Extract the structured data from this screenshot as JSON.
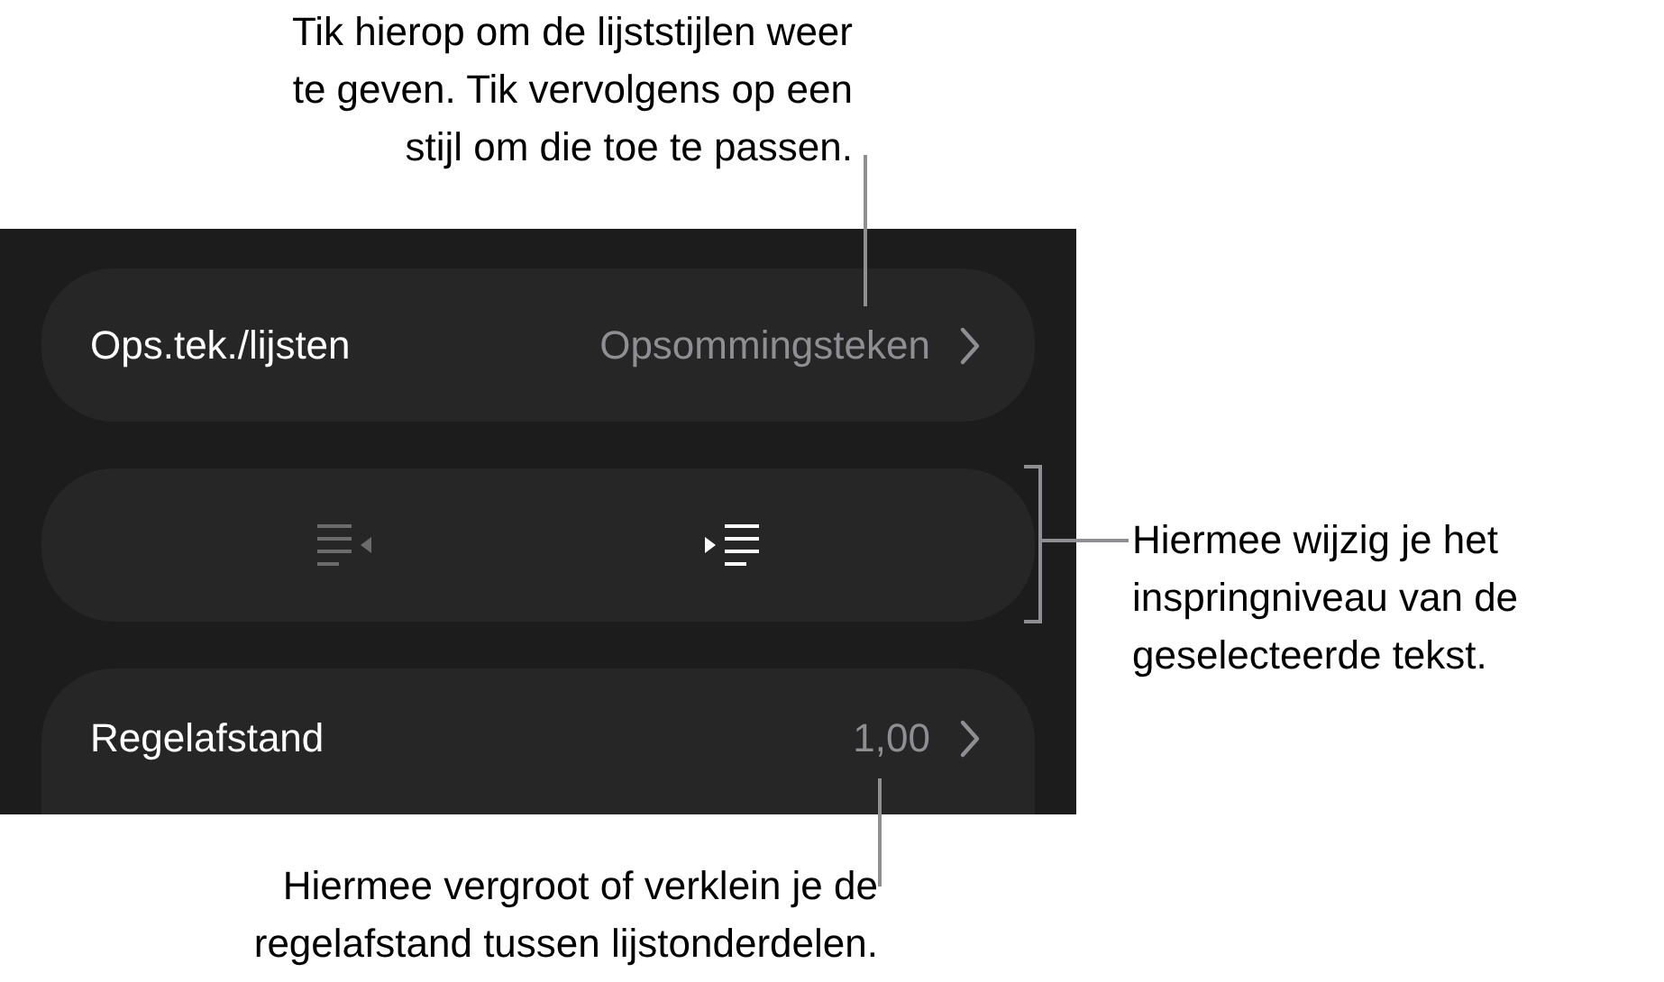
{
  "panel": {
    "bullets_row": {
      "label": "Ops.tek./lijsten",
      "value": "Opsommingsteken"
    },
    "indent_buttons": [
      {
        "kind": "outdent",
        "disabled": true
      },
      {
        "kind": "indent",
        "disabled": false
      }
    ],
    "spacing_row": {
      "label": "Regelafstand",
      "value": "1,00"
    }
  },
  "callouts": [
    {
      "kind": "top",
      "text": "Tik hierop om de lijststijlen weer\nte geven. Tik vervolgens op een\nstijl om die toe te passen."
    },
    {
      "kind": "right",
      "text": "Hiermee wijzig je het\ninspringniveau van de\ngeselecteerde tekst."
    },
    {
      "kind": "bottom",
      "text": "Hiermee vergroot of verklein je de\nregelafstand tussen lijstonderdelen."
    }
  ]
}
